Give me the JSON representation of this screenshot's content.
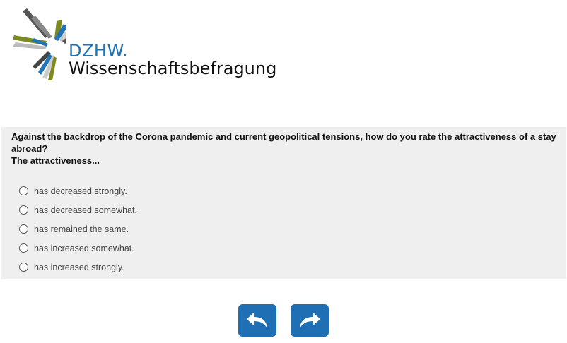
{
  "logo": {
    "brand": "DZHW.",
    "subtitle": "Wissenschaftsbefragung",
    "icon": "starburst-logo",
    "colors": {
      "blue": "#1f73b8",
      "olive": "#7d8a1f",
      "dark_gray": "#555555",
      "light_gray": "#cccccc"
    }
  },
  "question": {
    "text": "Against the backdrop of the Corona pandemic and current geopolitical tensions, how do you rate the attractiveness of a stay abroad?",
    "subtext": "The attractiveness...",
    "options": [
      {
        "label": "has decreased strongly.",
        "selected": false
      },
      {
        "label": "has decreased somewhat.",
        "selected": false
      },
      {
        "label": "has remained the same.",
        "selected": false
      },
      {
        "label": "has increased somewhat.",
        "selected": false
      },
      {
        "label": "has increased strongly.",
        "selected": false
      }
    ]
  },
  "navigation": {
    "back_icon": "back-arrow-icon",
    "next_icon": "forward-arrow-icon",
    "button_color": "#1f6fb5"
  }
}
